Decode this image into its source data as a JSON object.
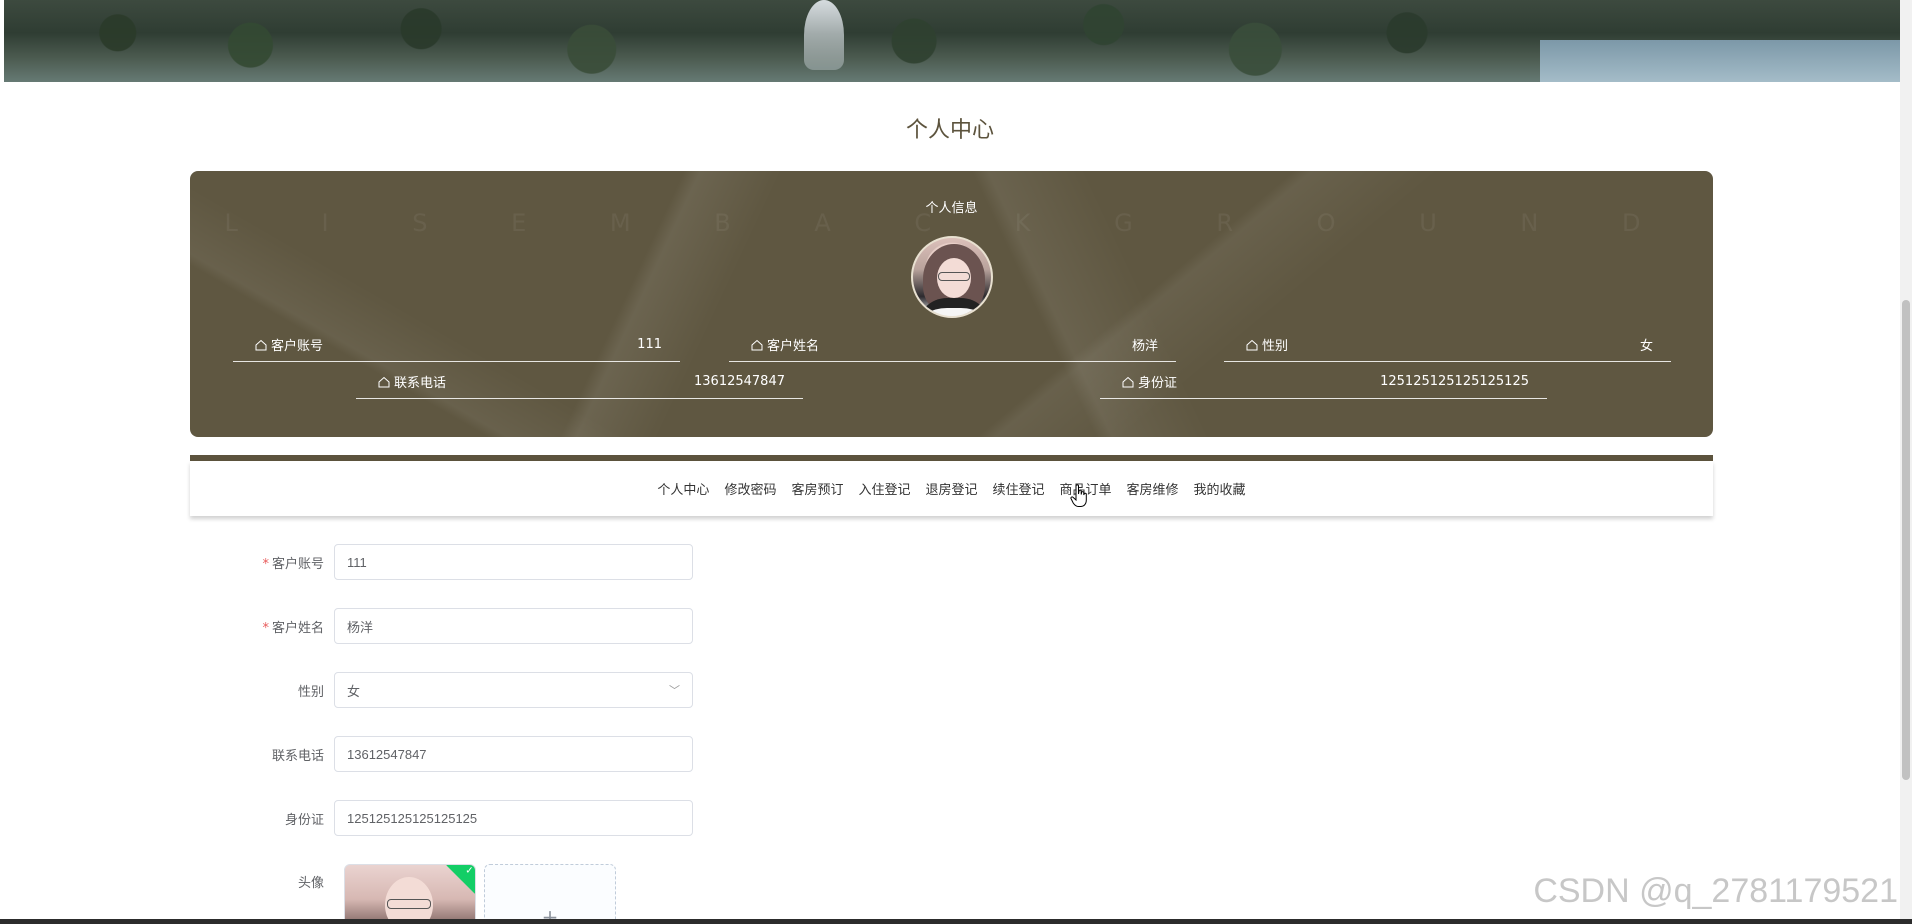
{
  "page": {
    "title": "个人中心"
  },
  "profile_card": {
    "title": "个人信息",
    "ghost_text": "L I S E M   B A C K G R O U N D",
    "fields": [
      {
        "label": "客户账号",
        "value": "111"
      },
      {
        "label": "客户姓名",
        "value": "杨洋"
      },
      {
        "label": "性别",
        "value": "女"
      },
      {
        "label": "联系电话",
        "value": "13612547847"
      },
      {
        "label": "身份证",
        "value": "125125125125125125"
      }
    ],
    "accent_color": "#5f5741"
  },
  "nav": {
    "items": [
      "个人中心",
      "修改密码",
      "客房预订",
      "入住登记",
      "退房登记",
      "续住登记",
      "商品订单",
      "客房维修",
      "我的收藏"
    ]
  },
  "form": {
    "account": {
      "label": "客户账号",
      "value": "111",
      "required": true
    },
    "name": {
      "label": "客户姓名",
      "value": "杨洋",
      "required": true
    },
    "gender": {
      "label": "性别",
      "value": "女"
    },
    "phone": {
      "label": "联系电话",
      "value": "13612547847"
    },
    "id_card": {
      "label": "身份证",
      "value": "125125125125125125"
    },
    "avatar": {
      "label": "头像",
      "add_symbol": "+"
    }
  },
  "watermark": "CSDN @q_2781179521"
}
